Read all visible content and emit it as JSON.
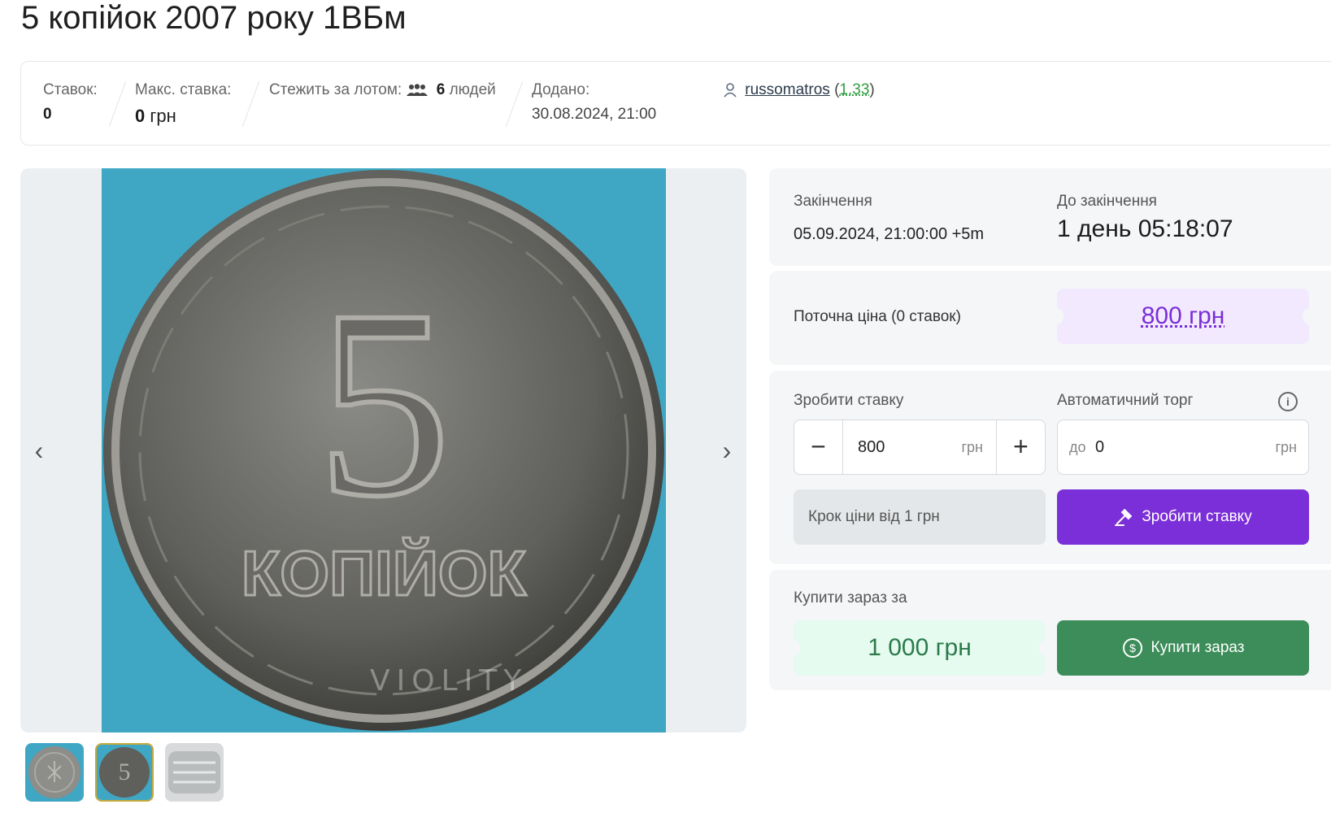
{
  "title": "5 копійок 2007 року 1ВБм",
  "stats": {
    "bids_label": "Ставок:",
    "bids_value": "0",
    "max_bid_label": "Макс. ставка:",
    "max_bid_value": "0",
    "max_bid_unit": "грн",
    "watching_label": "Стежить за лотом:",
    "watching_count": "6",
    "watching_unit": "людей",
    "added_label": "Додано:",
    "added_value": "30.08.2024, 21:00",
    "seller_name": "russomatros",
    "seller_rating": "1.33"
  },
  "gallery": {
    "prev_icon": "chevron-left-icon",
    "next_icon": "chevron-right-icon",
    "watermark": "VIOLITY",
    "coin_denomination": "5",
    "coin_word": "КОПІЙОК",
    "thumbnails": [
      "coin-reverse-thumb",
      "coin-obverse-thumb",
      "coin-edge-thumb"
    ],
    "active_thumbnail": 2
  },
  "timing": {
    "end_label": "Закінчення",
    "end_value": "05.09.2024, 21:00:00 +5m",
    "left_label": "До закінчення",
    "left_value": "1 день 05:18:07"
  },
  "price": {
    "label": "Поточна ціна (0 ставок)",
    "value": "800 грн"
  },
  "bid": {
    "label": "Зробити ставку",
    "minus": "−",
    "plus": "+",
    "value": "800",
    "unit": "грн",
    "auto_label": "Автоматичний торг",
    "auto_prefix": "до",
    "auto_value": "0",
    "auto_unit": "грн",
    "step_info": "Крок ціни від 1 грн",
    "button_label": "Зробити ставку"
  },
  "buy": {
    "label": "Купити зараз за",
    "price": "1 000 грн",
    "button_label": "Купити зараз"
  },
  "colors": {
    "accent_purple": "#7b2fd8",
    "buy_green": "#3c8d5a",
    "price_bg": "#f2e9ff",
    "buy_price_bg": "#e5fbef",
    "rating_green": "#2e9e3e"
  }
}
